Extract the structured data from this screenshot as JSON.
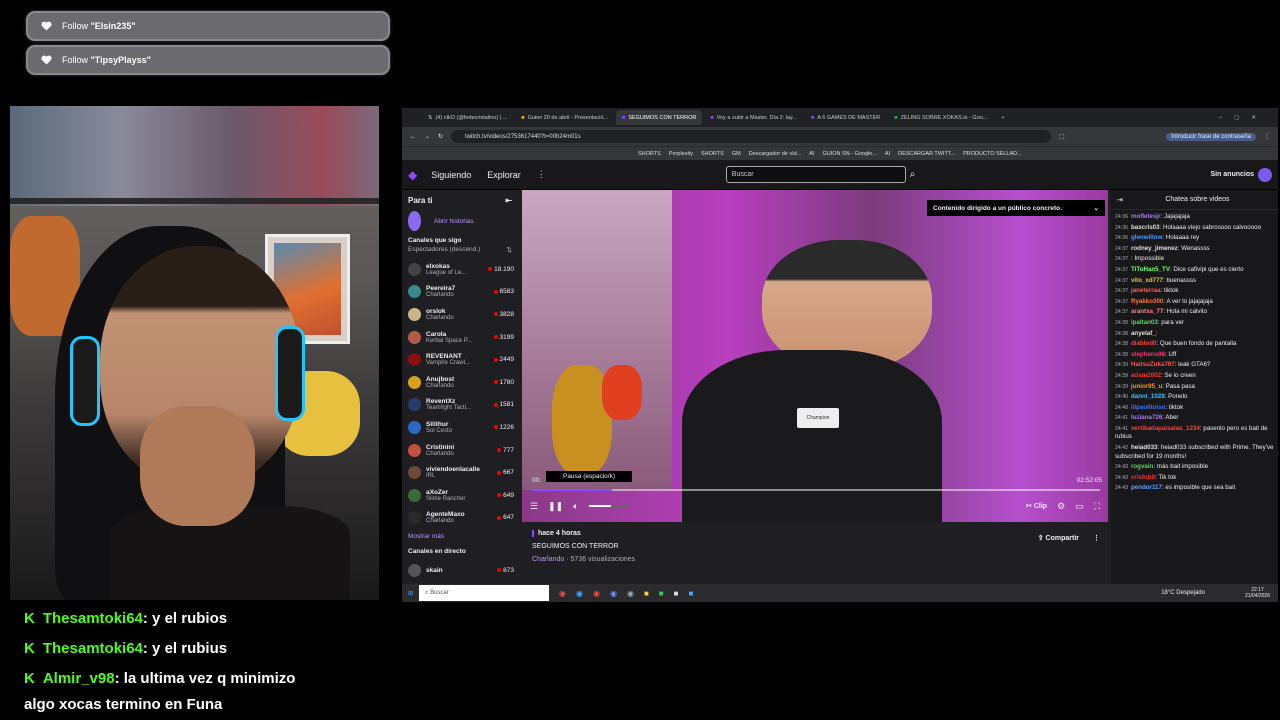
{
  "follows": [
    {
      "label": "Follow",
      "name": "\"Elsin235\""
    },
    {
      "label": "Follow",
      "name": "\"TipsyPlayss\""
    }
  ],
  "chrome": {
    "tabs": [
      {
        "title": "(4) ctkO (@fedecristalino) | ..."
      },
      {
        "title": "Guion 20 de abril - Presentació..."
      },
      {
        "title": "SEGUIMOS CON TERROR"
      },
      {
        "title": "Voy a subir a Master. Día 2: lay..."
      },
      {
        "title": "A 6 GAMES DE MASTER"
      },
      {
        "title": "ZELING SOBRE XOKAS.ts - Goo..."
      }
    ],
    "url": "twitch.tv/videos/2753617440?t=00h24m01s",
    "password_button": "Introducir frase de contraseña",
    "bookmarks": [
      "SHORTS",
      "Perplexity",
      "SHORTS",
      "GM",
      "Descargador de víd...",
      "AI",
      "GUION SN - Google...",
      "AI",
      "DESCARGAR TWITT...",
      "PRODUCTO SELLAD..."
    ]
  },
  "twitch": {
    "nav": {
      "following": "Siguiendo",
      "browse": "Explorar",
      "search_placeholder": "Buscar",
      "no_ads": "Sin anuncios"
    },
    "sidebar": {
      "for_you": "Para ti",
      "open_stories": "Abrir historias",
      "followed_title": "Canales que sigo",
      "followed_sort": "Espectadores (descend.)",
      "channels": [
        {
          "name": "elxokas",
          "game": "League of Le...",
          "viewers": "18.190",
          "color": "#444"
        },
        {
          "name": "Peereira7",
          "game": "Charlando",
          "viewers": "6583",
          "color": "#3a8a8c"
        },
        {
          "name": "orslok",
          "game": "Charlando",
          "viewers": "3828",
          "color": "#c9b68a"
        },
        {
          "name": "Carola",
          "game": "Kerbal Space P...",
          "viewers": "3199",
          "color": "#b25a4a"
        },
        {
          "name": "REVENANT",
          "game": "Vampire Crawl...",
          "viewers": "2449",
          "color": "#8a1010"
        },
        {
          "name": "Anujbost",
          "game": "Charlando",
          "viewers": "1780",
          "color": "#d8a020"
        },
        {
          "name": "ReventXz",
          "game": "Teamfight Tacti...",
          "viewers": "1581",
          "color": "#2a3a6a"
        },
        {
          "name": "Silithur",
          "game": "Sol Cesto",
          "viewers": "1226",
          "color": "#2a6ac0"
        },
        {
          "name": "Cristinini",
          "game": "Charlando",
          "viewers": "777",
          "color": "#c05040"
        },
        {
          "name": "viviendoenlacalle",
          "game": "IRL",
          "viewers": "667",
          "color": "#6a4a3a"
        },
        {
          "name": "aXoZer",
          "game": "Slime Rancher",
          "viewers": "649",
          "color": "#3a6a3a"
        },
        {
          "name": "AgenteMaxo",
          "game": "Charlando",
          "viewers": "647",
          "color": "#2a2a2a"
        }
      ],
      "show_more": "Mostrar más",
      "live_title": "Canales en directo",
      "live_channel": {
        "name": "skain",
        "viewers": "873"
      }
    },
    "player": {
      "mature_notice": "Contenido dirigido a un público concreto.",
      "time_current": "00:",
      "time_total": "02:52:05",
      "progress": 0.14,
      "volume": 0.55,
      "tooltip": "Pausa (espacio/k)",
      "clip": "Clip"
    },
    "video_info": {
      "ago": "hace 4 horas",
      "title": "SEGUIMOS CON TERROR",
      "category": "Charlando",
      "views": " · 5736 visualizaciones",
      "share": "Compartir"
    },
    "chat": {
      "title": "Chatea sobre videos",
      "messages": [
        {
          "time": "24:36",
          "user": "mofletesjr",
          "text": "Jajajajaja",
          "color": "#b070ff"
        },
        {
          "time": "24:36",
          "user": "bascris03",
          "text": "Holaaaa viejo sabrosooo calvooooo",
          "color": "#e0e0e0"
        },
        {
          "time": "24:36",
          "user": "glenwillow",
          "text": "Holaaaa rey",
          "color": "#4a9aff"
        },
        {
          "time": "24:37",
          "user": "rodney_jimenez",
          "text": "Wenassss",
          "color": "#e0e0e0"
        },
        {
          "time": "24:37",
          "user": "",
          "text": "Impossible",
          "color": "#2a4aff"
        },
        {
          "time": "24:37",
          "user": "TiToHan5_TV",
          "text": "Dice cafivipi que es cierto",
          "color": "#7aff7a"
        },
        {
          "time": "24:37",
          "user": "vito_xd777",
          "text": "buenassss",
          "color": "#f0c040"
        },
        {
          "time": "24:37",
          "user": "janeterraa",
          "text": "tiktok",
          "color": "#ff6060"
        },
        {
          "time": "24:37",
          "user": "Ryakko300",
          "text": "A ver lo jajajajaja",
          "color": "#ff7a30"
        },
        {
          "time": "24:37",
          "user": "arantxa_77",
          "text": "Hola mi calvito",
          "color": "#ff8080"
        },
        {
          "time": "24:38",
          "user": "ipaltan03",
          "text": "para ver",
          "color": "#60d060"
        },
        {
          "time": "24:38",
          "user": "anyelaf_",
          "text": "",
          "color": "#e0e0e0"
        },
        {
          "time": "24:38",
          "user": "diablod0",
          "text": "Que buen fondo de pantalla",
          "color": "#ff4040"
        },
        {
          "time": "24:38",
          "user": "stephens96",
          "text": "Uff",
          "color": "#ff3070"
        },
        {
          "time": "24:39",
          "user": "HaitsuZuka707",
          "text": "leak GTA6?",
          "color": "#ff5050"
        },
        {
          "time": "24:39",
          "user": "adam2002",
          "text": "Se lo creen",
          "color": "#ff3030"
        },
        {
          "time": "24:39",
          "user": "junior95_u",
          "text": "Pasa pasa",
          "color": "#ff9020"
        },
        {
          "time": "24:40",
          "user": "danni_1028",
          "text": "Ponelo",
          "color": "#40c0ff"
        },
        {
          "time": "24:40",
          "user": "lilpaolitoiso",
          "text": "tiktok",
          "color": "#4070ff"
        },
        {
          "time": "24:41",
          "user": "luziana726",
          "text": "Aber",
          "color": "#b070ff"
        },
        {
          "time": "24:41",
          "user": "vertikadapaisalas_1234",
          "text": "pasenlo pero es bait de rubius",
          "color": "#ff4040"
        },
        {
          "time": "24:42",
          "user": "heiad033",
          "text": "heiad033 subscribed with Prime. They've subscribed for 19 months!",
          "color": "#e0e0e0"
        },
        {
          "time": "24:43",
          "user": "rogvain",
          "text": "más bait imposible",
          "color": "#60d060"
        },
        {
          "time": "24:43",
          "user": "cristob0",
          "text": "Tik tok",
          "color": "#ff3030"
        },
        {
          "time": "24:43",
          "user": "pendor117",
          "text": "es imposible que sea bait",
          "color": "#60a0ff"
        }
      ]
    }
  },
  "taskbar": {
    "search": "Buscar",
    "weather": "18°C  Despejado",
    "time": "22:17",
    "date": "21/04/2026"
  },
  "overlay_chat": [
    {
      "user": "Thesamtoki64",
      "text": ": y el rubios"
    },
    {
      "user": "Thesamtoki64",
      "text": ": y el rubius"
    },
    {
      "user": "Almir_v98",
      "text": ": la ultima vez q minimizo",
      "text2": "algo xocas termino en Funa"
    }
  ],
  "colors": {
    "twitch_purple": "#9147ff",
    "kick_green": "#53fc18",
    "live_red": "#eb0400"
  }
}
